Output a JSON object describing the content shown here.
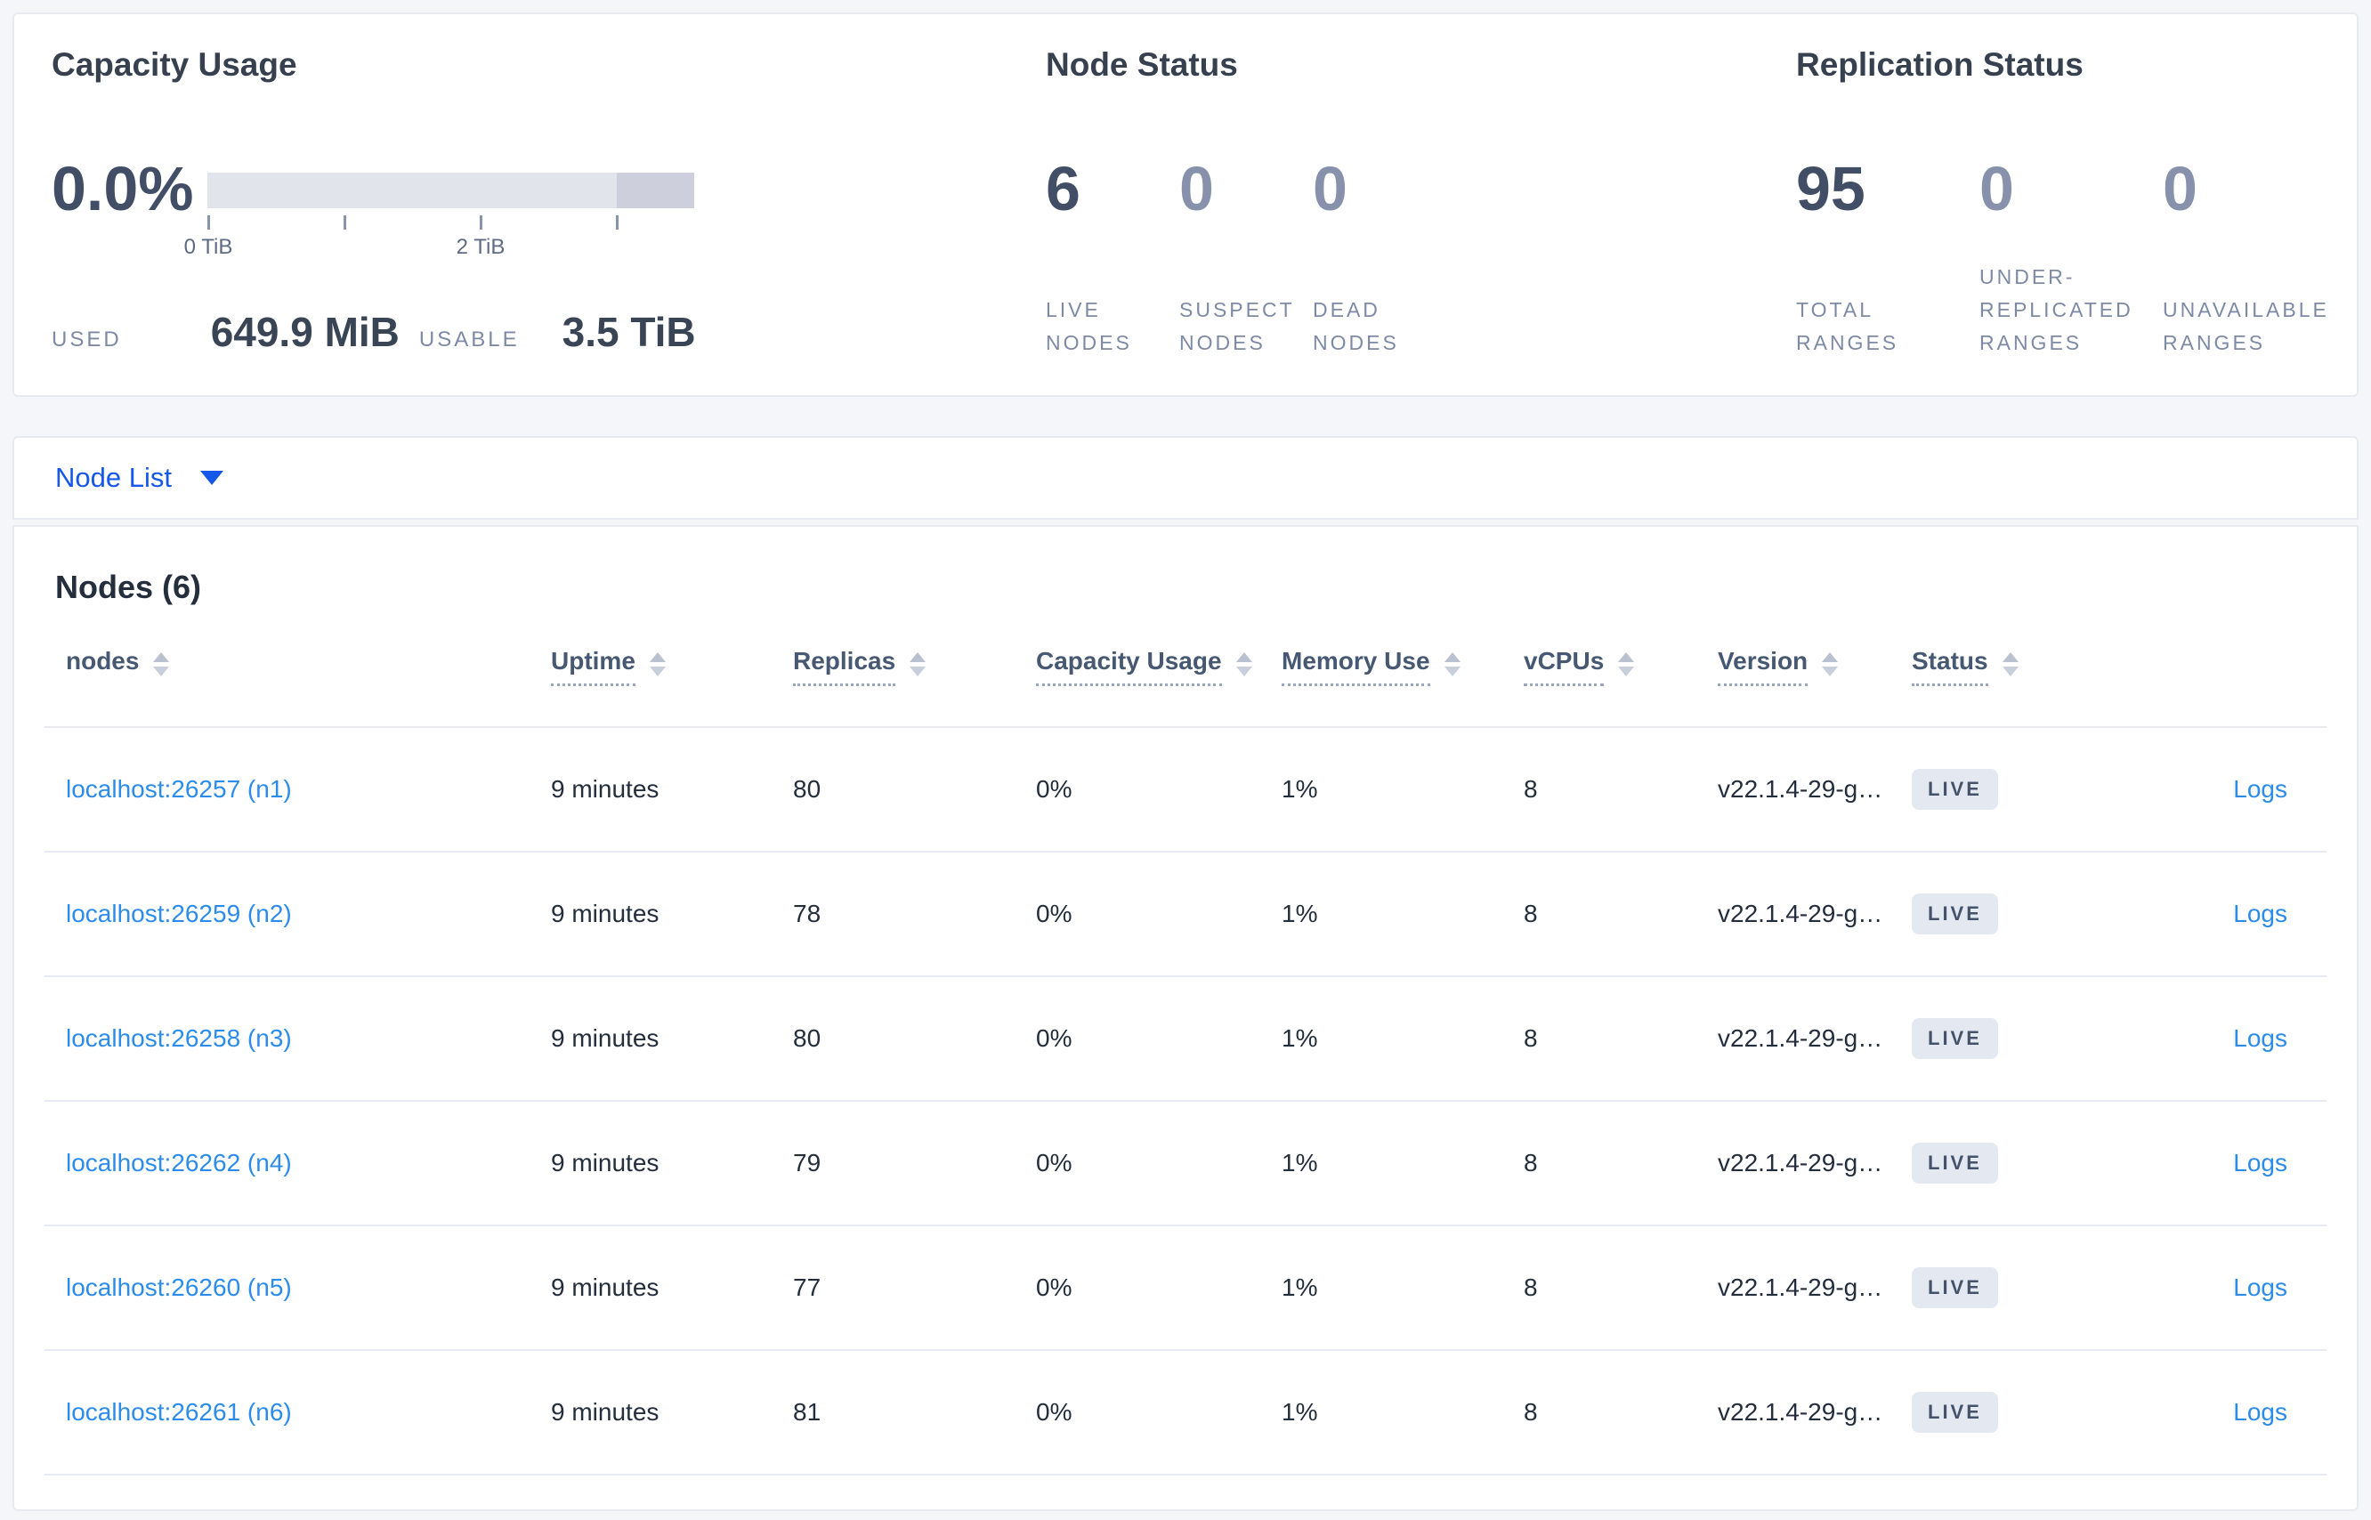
{
  "summary": {
    "capacity": {
      "title": "Capacity Usage",
      "percent": "0.0%",
      "tick_labels": [
        "0 TiB",
        "2 TiB"
      ],
      "used_label": "USED",
      "used_value": "649.9 MiB",
      "usable_label": "USABLE",
      "usable_value": "3.5 TiB"
    },
    "node_status": {
      "title": "Node Status",
      "stats": [
        {
          "value": "6",
          "label": "LIVE NODES",
          "muted": false
        },
        {
          "value": "0",
          "label": "SUSPECT NODES",
          "muted": true
        },
        {
          "value": "0",
          "label": "DEAD NODES",
          "muted": true
        }
      ]
    },
    "replication": {
      "title": "Replication Status",
      "stats": [
        {
          "value": "95",
          "label": "TOTAL RANGES",
          "muted": false
        },
        {
          "value": "0",
          "label": "UNDER-REPLICATED RANGES",
          "muted": true
        },
        {
          "value": "0",
          "label": "UNAVAILABLE RANGES",
          "muted": true
        }
      ]
    }
  },
  "nav": {
    "view_label": "Node List"
  },
  "nodes_table": {
    "title": "Nodes (6)",
    "headers": [
      "nodes",
      "Uptime",
      "Replicas",
      "Capacity Usage",
      "Memory Use",
      "vCPUs",
      "Version",
      "Status"
    ],
    "logs_label": "Logs",
    "rows": [
      {
        "host": "localhost:26257 (n1)",
        "uptime": "9 minutes",
        "replicas": "80",
        "capacity": "0%",
        "memory": "1%",
        "vcpus": "8",
        "version": "v22.1.4-29-g…",
        "status": "LIVE"
      },
      {
        "host": "localhost:26259 (n2)",
        "uptime": "9 minutes",
        "replicas": "78",
        "capacity": "0%",
        "memory": "1%",
        "vcpus": "8",
        "version": "v22.1.4-29-g…",
        "status": "LIVE"
      },
      {
        "host": "localhost:26258 (n3)",
        "uptime": "9 minutes",
        "replicas": "80",
        "capacity": "0%",
        "memory": "1%",
        "vcpus": "8",
        "version": "v22.1.4-29-g…",
        "status": "LIVE"
      },
      {
        "host": "localhost:26262 (n4)",
        "uptime": "9 minutes",
        "replicas": "79",
        "capacity": "0%",
        "memory": "1%",
        "vcpus": "8",
        "version": "v22.1.4-29-g…",
        "status": "LIVE"
      },
      {
        "host": "localhost:26260 (n5)",
        "uptime": "9 minutes",
        "replicas": "77",
        "capacity": "0%",
        "memory": "1%",
        "vcpus": "8",
        "version": "v22.1.4-29-g…",
        "status": "LIVE"
      },
      {
        "host": "localhost:26261 (n6)",
        "uptime": "9 minutes",
        "replicas": "81",
        "capacity": "0%",
        "memory": "1%",
        "vcpus": "8",
        "version": "v22.1.4-29-g…",
        "status": "LIVE"
      }
    ]
  },
  "colors": {
    "accent_blue": "#1557e8",
    "link_blue": "#2b8ceb",
    "dark_slate": "#414e66",
    "muted_slate": "#8791ab",
    "label_slate": "#7e8aa5",
    "badge_bg": "#e4e9f1",
    "bar_fill": "#e2e4ec",
    "bar_fill_dark": "#cdd0dc",
    "page_bg": "#f4f6f9",
    "live_status": "LIVE"
  }
}
